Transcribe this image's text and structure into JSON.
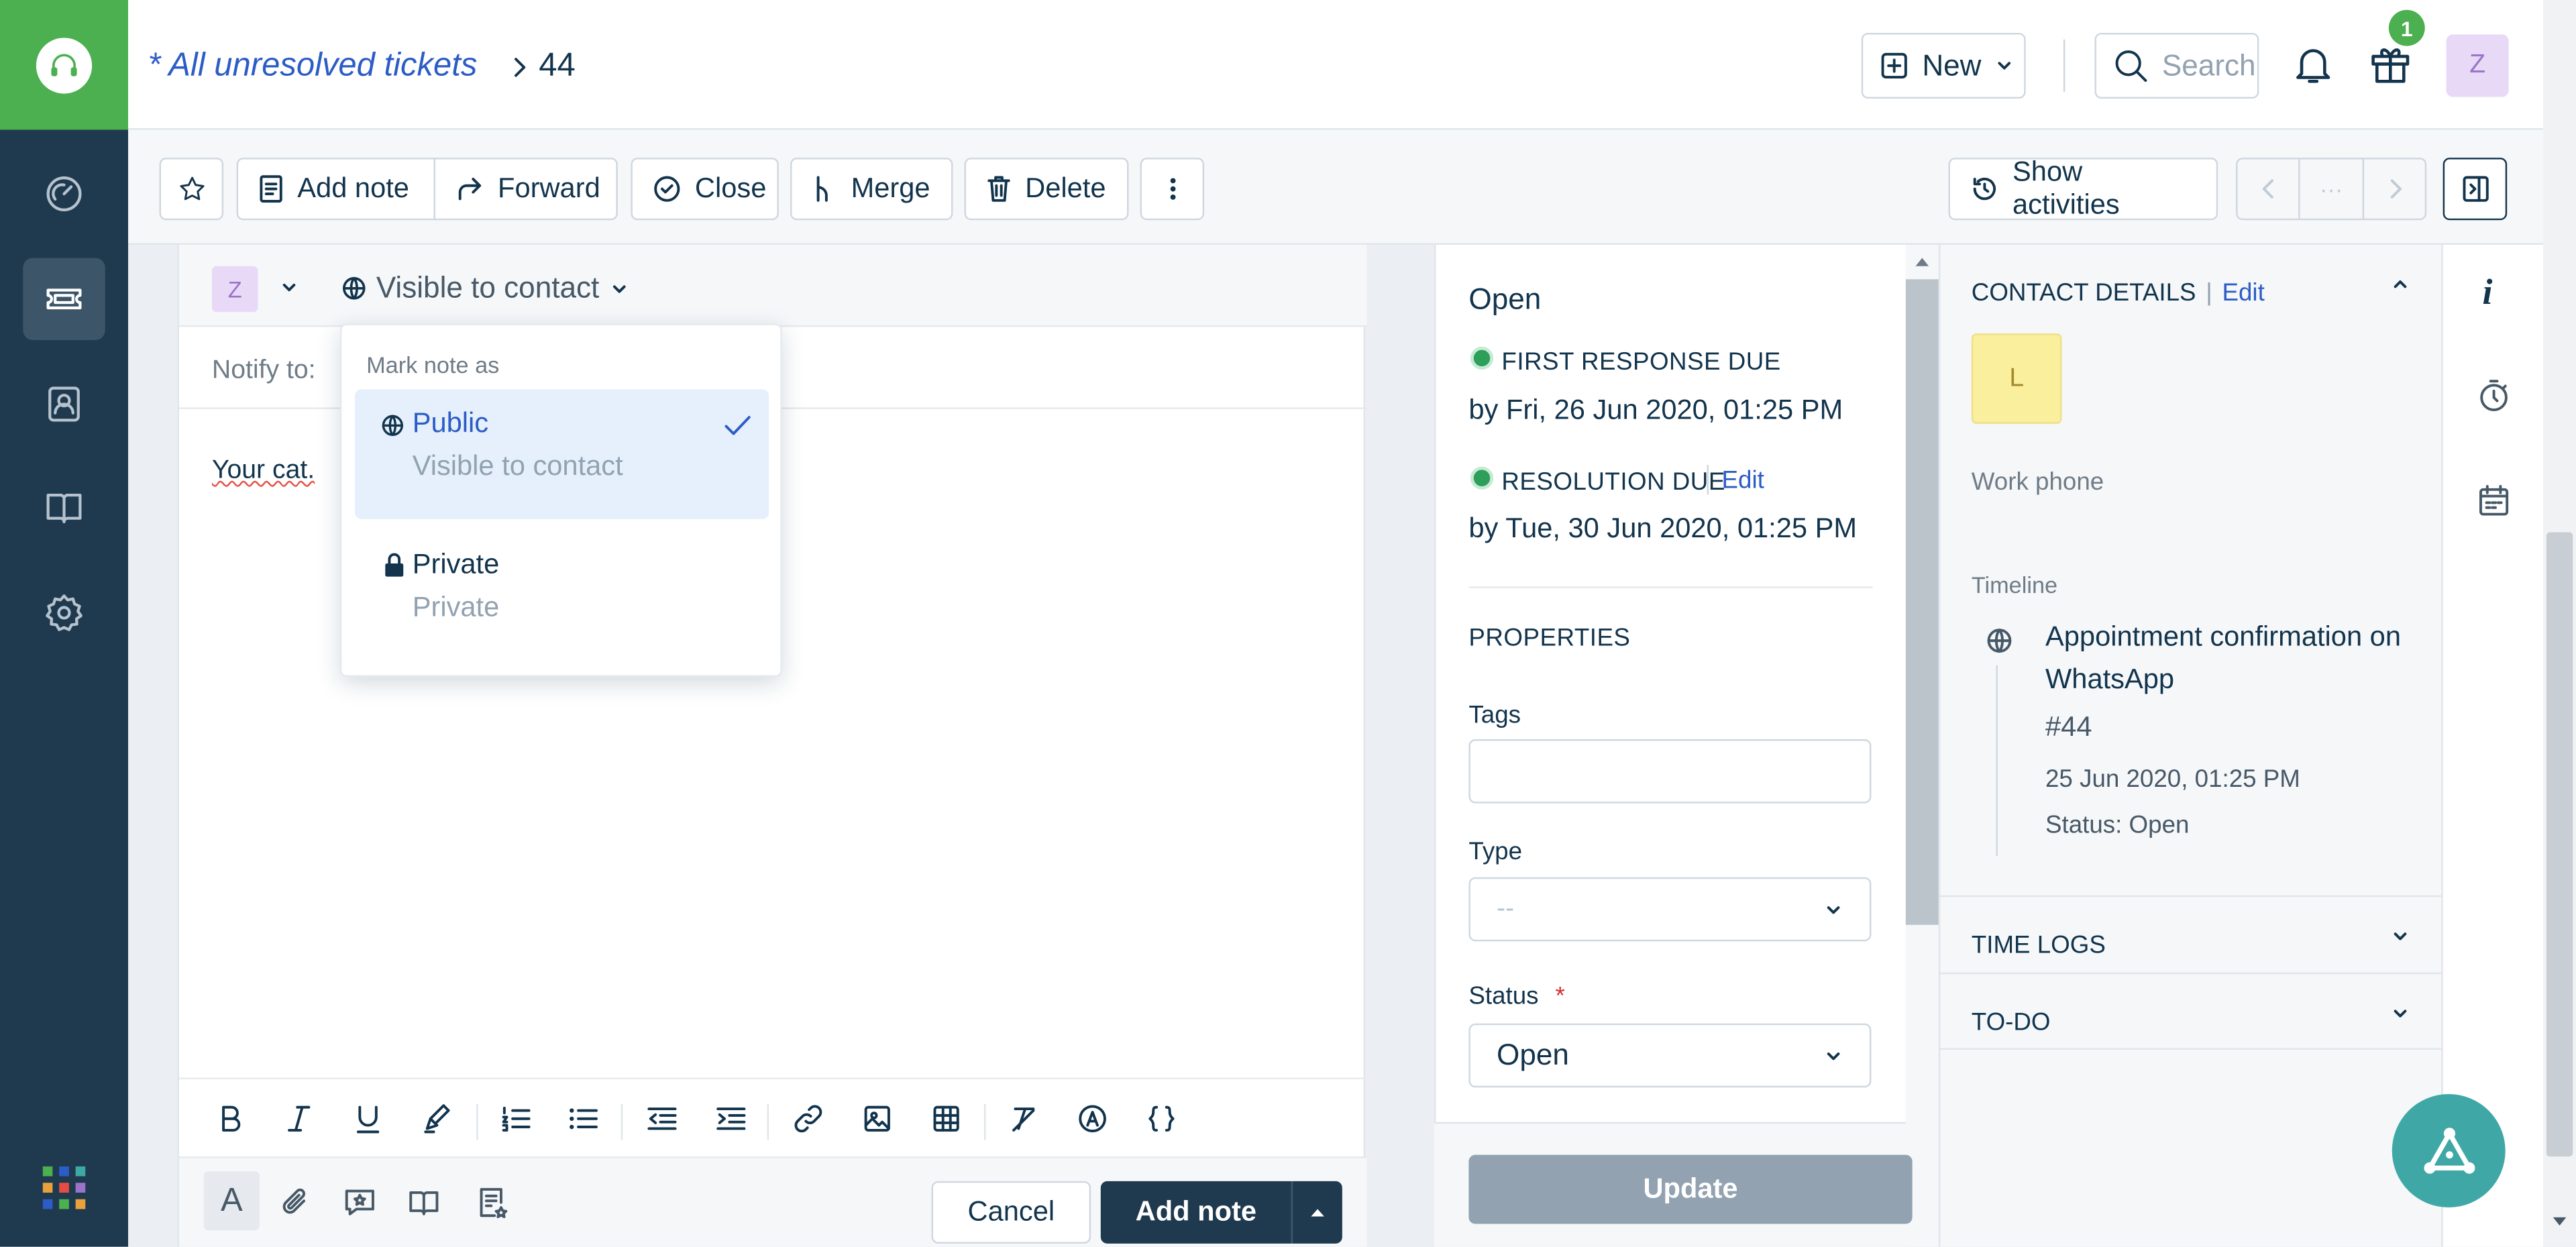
{
  "header": {
    "breadcrumb": "* All unresolved tickets",
    "ticket_number": "44",
    "new_label": "New",
    "search_placeholder": "Search",
    "gift_badge": "1",
    "avatar_initial": "Z"
  },
  "toolbar": {
    "add_note": "Add note",
    "forward": "Forward",
    "close": "Close",
    "merge": "Merge",
    "delete": "Delete",
    "show_activities": "Show activities",
    "pager_middle": "···"
  },
  "editor": {
    "avatar_initial": "Z",
    "visibility": "Visible to contact",
    "notify_label": "Notify to:",
    "body_text": "Your cat.",
    "cancel": "Cancel",
    "add_note": "Add note",
    "format_letter": "A"
  },
  "dropdown": {
    "title": "Mark note as",
    "options": [
      {
        "label": "Public",
        "sub": "Visible to contact",
        "selected": true
      },
      {
        "label": "Private",
        "sub": "Private",
        "selected": false
      }
    ]
  },
  "properties": {
    "status_title": "Open",
    "first_response_label": "FIRST RESPONSE DUE",
    "first_response_value": "by Fri, 26 Jun 2020, 01:25 PM",
    "resolution_label": "RESOLUTION DUE",
    "resolution_edit": "Edit",
    "resolution_value": "by Tue, 30 Jun 2020, 01:25 PM",
    "section_title": "PROPERTIES",
    "tags_label": "Tags",
    "type_label": "Type",
    "type_value": "--",
    "status_label": "Status",
    "required_mark": "*",
    "status_value": "Open",
    "update": "Update"
  },
  "contact": {
    "title": "CONTACT DETAILS",
    "separator": "|",
    "edit": "Edit",
    "avatar_initial": "L",
    "work_phone_label": "Work phone",
    "timeline_label": "Timeline",
    "timeline_item": {
      "title": "Appointment confirmation on WhatsApp",
      "number": "#44",
      "date": "25 Jun 2020, 01:25 PM",
      "status": "Status: Open"
    },
    "time_logs": "TIME LOGS",
    "todo": "TO-DO",
    "rail_info": "i"
  },
  "colors": {
    "brand_green": "#4caf50",
    "nav_bg": "#1f3a4f",
    "link_blue": "#2c5cc5",
    "sla_green": "#2e9e5b",
    "selected_bg": "#e5f0fc",
    "fab": "#3fa8a7"
  }
}
